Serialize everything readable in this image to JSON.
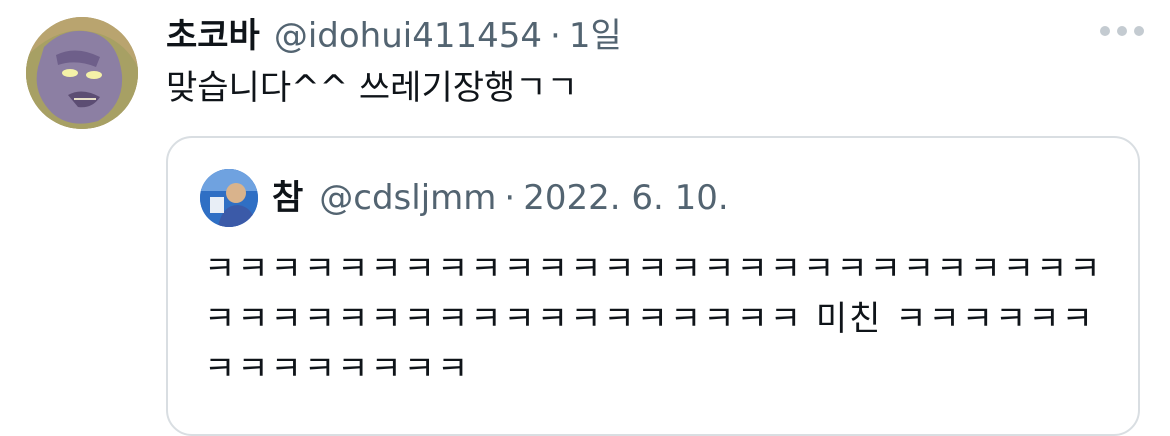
{
  "tweet": {
    "author_name": "초코바",
    "handle": "@idohui411454",
    "separator": "·",
    "time": "1일",
    "text": "맞습니다^^ 쓰레기장행ㄱㄱ",
    "avatar_icon": "gargoyle-cartoon-avatar",
    "more_icon": "more-dots-icon"
  },
  "quoted": {
    "author_name": "참",
    "handle": "@cdsljmm",
    "separator": "·",
    "date": "2022. 6. 10.",
    "avatar_icon": "person-photo-avatar",
    "lines": [
      "ㅋㅋㅋㅋㅋㅋㅋㅋㅋㅋㅋㅋㅋㅋㅋㅋㅋㅋㅋㅋㅋㅋㅋㅋㅋㅋㅋ",
      "ㅋㅋㅋㅋㅋㅋㅋㅋㅋㅋㅋㅋㅋㅋㅋㅋㅋㅋ 미친 ㅋㅋㅋㅋㅋㅋ",
      "ㅋㅋㅋㅋㅋㅋㅋㅋ"
    ]
  },
  "colors": {
    "text": "#0f1419",
    "muted": "#536471",
    "border": "#d9dee2"
  }
}
